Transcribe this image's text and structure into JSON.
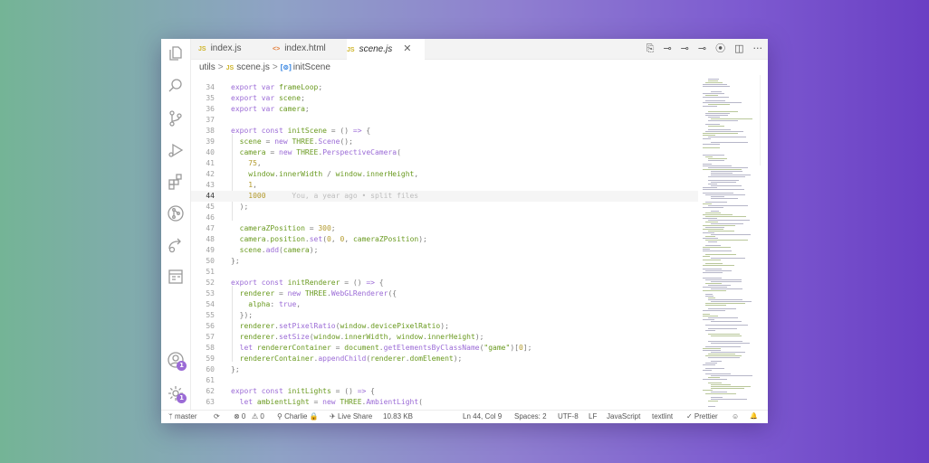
{
  "tabs": [
    {
      "label": "index.js",
      "icon": "JS",
      "type": "js",
      "active": false
    },
    {
      "label": "index.html",
      "icon": "<>",
      "type": "html",
      "active": false
    },
    {
      "label": "scene.js",
      "icon": "JS",
      "type": "js",
      "active": true
    }
  ],
  "tab_close_glyph": "✕",
  "toolbar_icons": [
    "⎘",
    "⊸",
    "⊸",
    "⊸",
    "⦿",
    "◫",
    "···"
  ],
  "breadcrumb": {
    "folder": "utils",
    "file_icon": "JS",
    "file": "scene.js",
    "symbol_icon": "[⊚]",
    "symbol": "initScene",
    "sep": ">"
  },
  "lines": [
    {
      "n": "34",
      "t": [
        [
          "k",
          "export "
        ],
        [
          "k",
          "var "
        ],
        [
          "v",
          "frameLoop"
        ],
        [
          "p",
          ";"
        ]
      ]
    },
    {
      "n": "35",
      "t": [
        [
          "k",
          "export "
        ],
        [
          "k",
          "var "
        ],
        [
          "v",
          "scene"
        ],
        [
          "p",
          ";"
        ]
      ]
    },
    {
      "n": "36",
      "t": [
        [
          "k",
          "export "
        ],
        [
          "k",
          "var "
        ],
        [
          "v",
          "camera"
        ],
        [
          "p",
          ";"
        ]
      ]
    },
    {
      "n": "37",
      "t": []
    },
    {
      "n": "38",
      "t": [
        [
          "k",
          "export "
        ],
        [
          "k",
          "const "
        ],
        [
          "v",
          "initScene"
        ],
        [
          "p",
          " = () "
        ],
        [
          "k",
          "=>"
        ],
        [
          "p",
          " {"
        ]
      ]
    },
    {
      "n": "39",
      "t": [
        [
          "p",
          "  "
        ],
        [
          "v",
          "scene"
        ],
        [
          "p",
          " = "
        ],
        [
          "k",
          "new "
        ],
        [
          "v",
          "THREE"
        ],
        [
          "p",
          "."
        ],
        [
          "fn",
          "Scene"
        ],
        [
          "p",
          "();"
        ]
      ]
    },
    {
      "n": "40",
      "t": [
        [
          "p",
          "  "
        ],
        [
          "v",
          "camera"
        ],
        [
          "p",
          " = "
        ],
        [
          "k",
          "new "
        ],
        [
          "v",
          "THREE"
        ],
        [
          "p",
          "."
        ],
        [
          "fn",
          "PerspectiveCamera"
        ],
        [
          "p",
          "("
        ]
      ]
    },
    {
      "n": "41",
      "t": [
        [
          "p",
          "    "
        ],
        [
          "n",
          "75"
        ],
        [
          "p",
          ","
        ]
      ]
    },
    {
      "n": "42",
      "t": [
        [
          "p",
          "    "
        ],
        [
          "v",
          "window"
        ],
        [
          "p",
          "."
        ],
        [
          "v",
          "innerWidth"
        ],
        [
          "p",
          " / "
        ],
        [
          "v",
          "window"
        ],
        [
          "p",
          "."
        ],
        [
          "v",
          "innerHeight"
        ],
        [
          "p",
          ","
        ]
      ]
    },
    {
      "n": "43",
      "t": [
        [
          "p",
          "    "
        ],
        [
          "n",
          "1"
        ],
        [
          "p",
          ","
        ]
      ]
    },
    {
      "n": "44",
      "t": [
        [
          "p",
          "    "
        ],
        [
          "n",
          "1000"
        ],
        [
          "ghost",
          "      You, a year ago • split files"
        ]
      ],
      "current": true
    },
    {
      "n": "45",
      "t": [
        [
          "p",
          "  );"
        ]
      ]
    },
    {
      "n": "46",
      "t": []
    },
    {
      "n": "47",
      "t": [
        [
          "p",
          "  "
        ],
        [
          "v",
          "cameraZPosition"
        ],
        [
          "p",
          " = "
        ],
        [
          "n",
          "300"
        ],
        [
          "p",
          ";"
        ]
      ]
    },
    {
      "n": "48",
      "t": [
        [
          "p",
          "  "
        ],
        [
          "v",
          "camera"
        ],
        [
          "p",
          "."
        ],
        [
          "v",
          "position"
        ],
        [
          "p",
          "."
        ],
        [
          "fn",
          "set"
        ],
        [
          "p",
          "("
        ],
        [
          "n",
          "0"
        ],
        [
          "p",
          ", "
        ],
        [
          "n",
          "0"
        ],
        [
          "p",
          ", "
        ],
        [
          "v",
          "cameraZPosition"
        ],
        [
          "p",
          ");"
        ]
      ]
    },
    {
      "n": "49",
      "t": [
        [
          "p",
          "  "
        ],
        [
          "v",
          "scene"
        ],
        [
          "p",
          "."
        ],
        [
          "fn",
          "add"
        ],
        [
          "p",
          "("
        ],
        [
          "v",
          "camera"
        ],
        [
          "p",
          ");"
        ]
      ]
    },
    {
      "n": "50",
      "t": [
        [
          "p",
          "};"
        ]
      ]
    },
    {
      "n": "51",
      "t": []
    },
    {
      "n": "52",
      "t": [
        [
          "k",
          "export "
        ],
        [
          "k",
          "const "
        ],
        [
          "v",
          "initRenderer"
        ],
        [
          "p",
          " = () "
        ],
        [
          "k",
          "=>"
        ],
        [
          "p",
          " {"
        ]
      ]
    },
    {
      "n": "53",
      "t": [
        [
          "p",
          "  "
        ],
        [
          "v",
          "renderer"
        ],
        [
          "p",
          " = "
        ],
        [
          "k",
          "new "
        ],
        [
          "v",
          "THREE"
        ],
        [
          "p",
          "."
        ],
        [
          "fn",
          "WebGLRenderer"
        ],
        [
          "p",
          "({"
        ]
      ]
    },
    {
      "n": "54",
      "t": [
        [
          "p",
          "    "
        ],
        [
          "v",
          "alpha"
        ],
        [
          "p",
          ": "
        ],
        [
          "k",
          "true"
        ],
        [
          "p",
          ","
        ]
      ]
    },
    {
      "n": "55",
      "t": [
        [
          "p",
          "  });"
        ]
      ]
    },
    {
      "n": "56",
      "t": [
        [
          "p",
          "  "
        ],
        [
          "v",
          "renderer"
        ],
        [
          "p",
          "."
        ],
        [
          "fn",
          "setPixelRatio"
        ],
        [
          "p",
          "("
        ],
        [
          "v",
          "window"
        ],
        [
          "p",
          "."
        ],
        [
          "v",
          "devicePixelRatio"
        ],
        [
          "p",
          ");"
        ]
      ]
    },
    {
      "n": "57",
      "t": [
        [
          "p",
          "  "
        ],
        [
          "v",
          "renderer"
        ],
        [
          "p",
          "."
        ],
        [
          "fn",
          "setSize"
        ],
        [
          "p",
          "("
        ],
        [
          "v",
          "window"
        ],
        [
          "p",
          "."
        ],
        [
          "v",
          "innerWidth"
        ],
        [
          "p",
          ", "
        ],
        [
          "v",
          "window"
        ],
        [
          "p",
          "."
        ],
        [
          "v",
          "innerHeight"
        ],
        [
          "p",
          ");"
        ]
      ]
    },
    {
      "n": "58",
      "t": [
        [
          "p",
          "  "
        ],
        [
          "k",
          "let "
        ],
        [
          "v",
          "rendererContainer"
        ],
        [
          "p",
          " = "
        ],
        [
          "v",
          "document"
        ],
        [
          "p",
          "."
        ],
        [
          "fn",
          "getElementsByClassName"
        ],
        [
          "p",
          "("
        ],
        [
          "s",
          "\"game\""
        ],
        [
          "p",
          ")["
        ],
        [
          "n",
          "0"
        ],
        [
          "p",
          "];"
        ]
      ]
    },
    {
      "n": "59",
      "t": [
        [
          "p",
          "  "
        ],
        [
          "v",
          "rendererContainer"
        ],
        [
          "p",
          "."
        ],
        [
          "fn",
          "appendChild"
        ],
        [
          "p",
          "("
        ],
        [
          "v",
          "renderer"
        ],
        [
          "p",
          "."
        ],
        [
          "v",
          "domElement"
        ],
        [
          "p",
          ");"
        ]
      ]
    },
    {
      "n": "60",
      "t": [
        [
          "p",
          "};"
        ]
      ]
    },
    {
      "n": "61",
      "t": []
    },
    {
      "n": "62",
      "t": [
        [
          "k",
          "export "
        ],
        [
          "k",
          "const "
        ],
        [
          "v",
          "initLights"
        ],
        [
          "p",
          " = () "
        ],
        [
          "k",
          "=>"
        ],
        [
          "p",
          " {"
        ]
      ]
    },
    {
      "n": "63",
      "t": [
        [
          "p",
          "  "
        ],
        [
          "k",
          "let "
        ],
        [
          "v",
          "ambientLight"
        ],
        [
          "p",
          " = "
        ],
        [
          "k",
          "new "
        ],
        [
          "v",
          "THREE"
        ],
        [
          "p",
          "."
        ],
        [
          "fn",
          "AmbientLight"
        ],
        [
          "p",
          "("
        ]
      ]
    }
  ],
  "status": {
    "branch": "master",
    "sync_icon": "⟳",
    "errors": "⊗ 0",
    "warnings": "⚠ 0",
    "user": "Charlie 🔒",
    "live_share": "Live Share",
    "size": "10.83 KB",
    "position": "Ln 44, Col 9",
    "spaces": "Spaces: 2",
    "encoding": "UTF-8",
    "eol": "LF",
    "language": "JavaScript",
    "lint": "textlint",
    "prettier": "✓ Prettier",
    "feedback_icon": "☺",
    "bell_icon": "🔔"
  },
  "activity_badges": {
    "accounts": "1",
    "settings": "1"
  },
  "colors": {
    "accent": "#9b6bd6",
    "keyword": "#9b6bd6",
    "identifier": "#6a9a20",
    "number": "#b39a2c"
  }
}
